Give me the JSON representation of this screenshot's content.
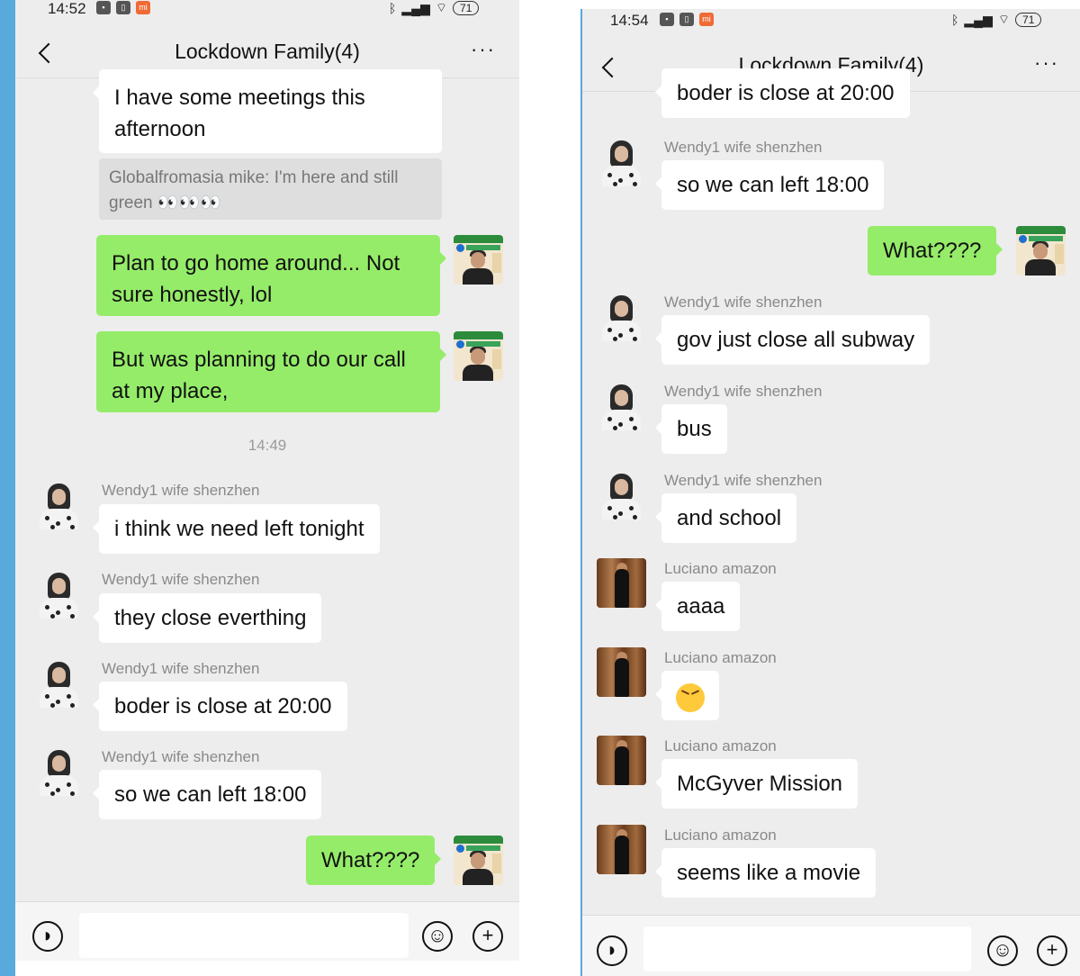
{
  "left": {
    "status": {
      "time": "14:52",
      "battery": "71"
    },
    "title": "Lockdown Family(4)",
    "more": "···",
    "messages": [
      {
        "text": "I have some meetings this afternoon"
      },
      {
        "quote": "Globalfromasia mike: I'm here and still green 👀👀👀"
      },
      {
        "text": "Plan to go home around... Not sure honestly, lol"
      },
      {
        "text": "But was planning to do our call at my place,"
      },
      {
        "time": "14:49"
      },
      {
        "sender": "Wendy1 wife shenzhen",
        "text": "i think we need left tonight"
      },
      {
        "sender": "Wendy1 wife shenzhen",
        "text": "they close everthing"
      },
      {
        "sender": "Wendy1 wife shenzhen",
        "text": "boder is close at 20:00"
      },
      {
        "sender": "Wendy1 wife shenzhen",
        "text": "so we can left 18:00"
      },
      {
        "text": "What????"
      }
    ]
  },
  "right": {
    "status": {
      "time": "14:54",
      "battery": "71"
    },
    "title": "Lockdown Family(4)",
    "more": "···",
    "messages": [
      {
        "text": "boder is close at 20:00"
      },
      {
        "sender": "Wendy1 wife shenzhen",
        "text": "so we can left 18:00"
      },
      {
        "text": "What????"
      },
      {
        "sender": "Wendy1 wife shenzhen",
        "text": "gov just close all subway"
      },
      {
        "sender": "Wendy1 wife shenzhen",
        "text": "bus"
      },
      {
        "sender": "Wendy1 wife shenzhen",
        "text": "and school"
      },
      {
        "sender": "Luciano amazon",
        "text": "aaaa"
      },
      {
        "sender": "Luciano amazon",
        "emoji": "angry-face"
      },
      {
        "sender": "Luciano amazon",
        "text": "McGyver Mission"
      },
      {
        "sender": "Luciano amazon",
        "text": "seems like a movie"
      }
    ]
  },
  "colors": {
    "outgoing_bubble": "#95ec69",
    "incoming_bubble": "#ffffff",
    "chat_background": "#ededed",
    "accent_edge": "#58a9dc"
  }
}
